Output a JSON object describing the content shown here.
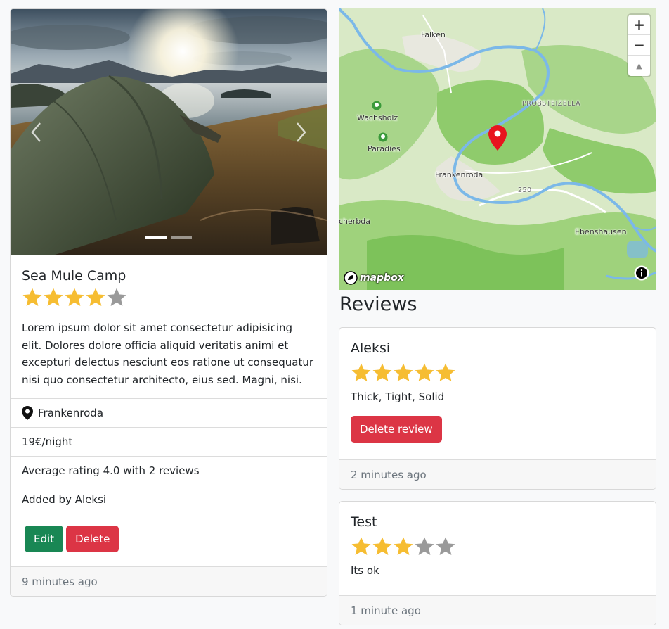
{
  "campground": {
    "title": "Sea Mule Camp",
    "rating": 4,
    "description": "Lorem ipsum dolor sit amet consectetur adipisicing elit. Dolores dolore officia aliquid veritatis animi et excepturi delectus nesciunt eos ratione ut consequatur nisi quo consectetur architecto, eius sed. Magni, nisi.",
    "location": "Frankenroda",
    "price": "19€/night",
    "average_rating": "Average rating 4.0 with 2 reviews",
    "added_by": "Added by Aleksi",
    "edit_label": "Edit",
    "delete_label": "Delete",
    "posted": "9 minutes ago",
    "carousel": {
      "slides": 2,
      "active_index": 0
    }
  },
  "map": {
    "zoom_in": "+",
    "zoom_out": "−",
    "compass": "▲",
    "logo": "mapbox",
    "places": {
      "falken": "Falken",
      "probsteizella": "PROBSTEIZELLA",
      "wachsholz": "Wachsholz",
      "paradies": "Paradies",
      "frankenroda": "Frankenroda",
      "road": "250",
      "scherbda": "cherbda",
      "ebenshausen": "Ebenshausen"
    }
  },
  "reviews": {
    "heading": "Reviews",
    "items": [
      {
        "author": "Aleksi",
        "rating": 5,
        "text": "Thick, Tight, Solid",
        "delete_label": "Delete review",
        "posted": "2 minutes ago"
      },
      {
        "author": "Test",
        "rating": 3,
        "text": "Its ok",
        "posted": "1 minute ago"
      }
    ]
  },
  "colors": {
    "star_filled": "#f6bd32",
    "star_empty": "#9a9a9a",
    "success": "#198754",
    "danger": "#dc3545",
    "map_pin": "#e8141e",
    "river": "#7bb8e8"
  }
}
